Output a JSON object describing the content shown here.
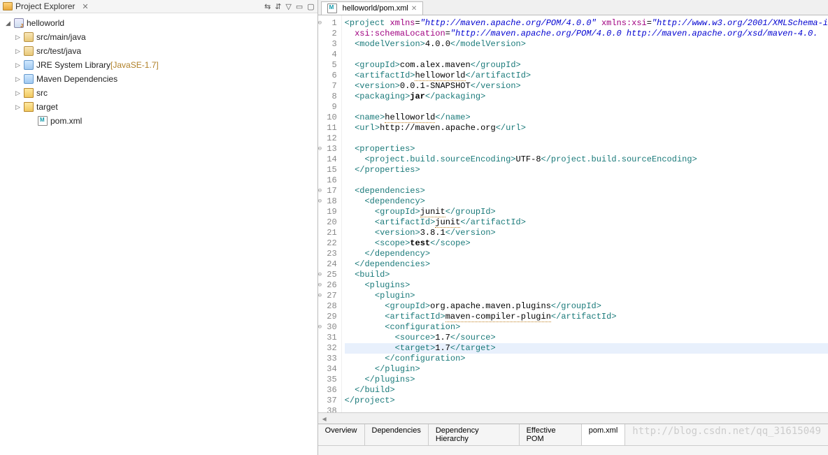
{
  "explorer": {
    "title": "Project Explorer",
    "project": "helloworld",
    "items": [
      {
        "label": "src/main/java",
        "icon": "pkg"
      },
      {
        "label": "src/test/java",
        "icon": "pkg"
      },
      {
        "label": "JRE System Library",
        "suffix": "[JavaSE-1.7]",
        "icon": "lib"
      },
      {
        "label": "Maven Dependencies",
        "icon": "lib"
      },
      {
        "label": "src",
        "icon": "foldr"
      },
      {
        "label": "target",
        "icon": "foldr"
      }
    ],
    "file": "pom.xml"
  },
  "editor": {
    "tab": "helloworld/pom.xml",
    "gutter_lines": 38,
    "fold_lines": [
      1,
      13,
      17,
      18,
      25,
      26,
      27,
      30
    ],
    "highlight_line": 32,
    "code_lines": [
      [
        {
          "t": "tag",
          "v": "<project"
        },
        {
          "t": "txt",
          "v": " "
        },
        {
          "t": "attrname",
          "v": "xmlns"
        },
        {
          "t": "txt",
          "v": "="
        },
        {
          "t": "str",
          "v": "\"http://maven.apache.org/POM/4.0.0\""
        },
        {
          "t": "txt",
          "v": " "
        },
        {
          "t": "attrname",
          "v": "xmlns:xsi"
        },
        {
          "t": "txt",
          "v": "="
        },
        {
          "t": "str",
          "v": "\"http://www.w3.org/2001/XMLSchema-i"
        }
      ],
      [
        {
          "t": "txt",
          "v": "  "
        },
        {
          "t": "attrname",
          "v": "xsi:schemaLocation"
        },
        {
          "t": "txt",
          "v": "="
        },
        {
          "t": "str",
          "v": "\"http://maven.apache.org/POM/4.0.0 http://maven.apache.org/xsd/maven-4.0."
        }
      ],
      [
        {
          "t": "txt",
          "v": "  "
        },
        {
          "t": "tag",
          "v": "<modelVersion>"
        },
        {
          "t": "txt",
          "v": "4.0.0"
        },
        {
          "t": "tag",
          "v": "</modelVersion>"
        }
      ],
      [
        {
          "t": "txt",
          "v": ""
        }
      ],
      [
        {
          "t": "txt",
          "v": "  "
        },
        {
          "t": "tag",
          "v": "<groupId>"
        },
        {
          "t": "txt",
          "v": "com.alex.maven"
        },
        {
          "t": "tag",
          "v": "</groupId>"
        }
      ],
      [
        {
          "t": "txt",
          "v": "  "
        },
        {
          "t": "tag",
          "v": "<artifactId>"
        },
        {
          "t": "under",
          "v": "helloworld"
        },
        {
          "t": "tag",
          "v": "</artifactId>"
        }
      ],
      [
        {
          "t": "txt",
          "v": "  "
        },
        {
          "t": "tag",
          "v": "<version>"
        },
        {
          "t": "txt",
          "v": "0.0.1-SNAPSHOT"
        },
        {
          "t": "tag",
          "v": "</version>"
        }
      ],
      [
        {
          "t": "txt",
          "v": "  "
        },
        {
          "t": "tag",
          "v": "<packaging>"
        },
        {
          "t": "kw",
          "v": "jar"
        },
        {
          "t": "tag",
          "v": "</packaging>"
        }
      ],
      [
        {
          "t": "txt",
          "v": ""
        }
      ],
      [
        {
          "t": "txt",
          "v": "  "
        },
        {
          "t": "tag",
          "v": "<name>"
        },
        {
          "t": "under",
          "v": "helloworld"
        },
        {
          "t": "tag",
          "v": "</name>"
        }
      ],
      [
        {
          "t": "txt",
          "v": "  "
        },
        {
          "t": "tag",
          "v": "<url>"
        },
        {
          "t": "txt",
          "v": "http://maven.apache.org"
        },
        {
          "t": "tag",
          "v": "</url>"
        }
      ],
      [
        {
          "t": "txt",
          "v": ""
        }
      ],
      [
        {
          "t": "txt",
          "v": "  "
        },
        {
          "t": "tag",
          "v": "<properties>"
        }
      ],
      [
        {
          "t": "txt",
          "v": "    "
        },
        {
          "t": "tag",
          "v": "<project.build.sourceEncoding>"
        },
        {
          "t": "txt",
          "v": "UTF-8"
        },
        {
          "t": "tag",
          "v": "</project.build.sourceEncoding>"
        }
      ],
      [
        {
          "t": "txt",
          "v": "  "
        },
        {
          "t": "tag",
          "v": "</properties>"
        }
      ],
      [
        {
          "t": "txt",
          "v": ""
        }
      ],
      [
        {
          "t": "txt",
          "v": "  "
        },
        {
          "t": "tag",
          "v": "<dependencies>"
        }
      ],
      [
        {
          "t": "txt",
          "v": "    "
        },
        {
          "t": "tag",
          "v": "<dependency>"
        }
      ],
      [
        {
          "t": "txt",
          "v": "      "
        },
        {
          "t": "tag",
          "v": "<groupId>"
        },
        {
          "t": "under",
          "v": "junit"
        },
        {
          "t": "tag",
          "v": "</groupId>"
        }
      ],
      [
        {
          "t": "txt",
          "v": "      "
        },
        {
          "t": "tag",
          "v": "<artifactId>"
        },
        {
          "t": "under",
          "v": "junit"
        },
        {
          "t": "tag",
          "v": "</artifactId>"
        }
      ],
      [
        {
          "t": "txt",
          "v": "      "
        },
        {
          "t": "tag",
          "v": "<version>"
        },
        {
          "t": "txt",
          "v": "3.8.1"
        },
        {
          "t": "tag",
          "v": "</version>"
        }
      ],
      [
        {
          "t": "txt",
          "v": "      "
        },
        {
          "t": "tag",
          "v": "<scope>"
        },
        {
          "t": "kw",
          "v": "test"
        },
        {
          "t": "tag",
          "v": "</scope>"
        }
      ],
      [
        {
          "t": "txt",
          "v": "    "
        },
        {
          "t": "tag",
          "v": "</dependency>"
        }
      ],
      [
        {
          "t": "txt",
          "v": "  "
        },
        {
          "t": "tag",
          "v": "</dependencies>"
        }
      ],
      [
        {
          "t": "txt",
          "v": "  "
        },
        {
          "t": "tag",
          "v": "<build>"
        }
      ],
      [
        {
          "t": "txt",
          "v": "    "
        },
        {
          "t": "tag",
          "v": "<plugins>"
        }
      ],
      [
        {
          "t": "txt",
          "v": "      "
        },
        {
          "t": "tag",
          "v": "<plugin>"
        }
      ],
      [
        {
          "t": "txt",
          "v": "        "
        },
        {
          "t": "tag",
          "v": "<groupId>"
        },
        {
          "t": "txt",
          "v": "org.apache.maven.plugins"
        },
        {
          "t": "tag",
          "v": "</groupId>"
        }
      ],
      [
        {
          "t": "txt",
          "v": "        "
        },
        {
          "t": "tag",
          "v": "<artifactId>"
        },
        {
          "t": "under",
          "v": "maven-compiler-plugin"
        },
        {
          "t": "tag",
          "v": "</artifactId>"
        }
      ],
      [
        {
          "t": "txt",
          "v": "        "
        },
        {
          "t": "tag",
          "v": "<configuration>"
        }
      ],
      [
        {
          "t": "txt",
          "v": "          "
        },
        {
          "t": "tag",
          "v": "<source>"
        },
        {
          "t": "txt",
          "v": "1.7"
        },
        {
          "t": "tag",
          "v": "</source>"
        }
      ],
      [
        {
          "t": "txt",
          "v": "          "
        },
        {
          "t": "tag",
          "v": "<target>"
        },
        {
          "t": "txt",
          "v": "1.7"
        },
        {
          "t": "tag",
          "v": "</target>"
        }
      ],
      [
        {
          "t": "txt",
          "v": "        "
        },
        {
          "t": "tag",
          "v": "</configuration>"
        }
      ],
      [
        {
          "t": "txt",
          "v": "      "
        },
        {
          "t": "tag",
          "v": "</plugin>"
        }
      ],
      [
        {
          "t": "txt",
          "v": "    "
        },
        {
          "t": "tag",
          "v": "</plugins>"
        }
      ],
      [
        {
          "t": "txt",
          "v": "  "
        },
        {
          "t": "tag",
          "v": "</build>"
        }
      ],
      [
        {
          "t": "tag",
          "v": "</project>"
        }
      ],
      [
        {
          "t": "txt",
          "v": ""
        }
      ]
    ]
  },
  "bottom_tabs": [
    "Overview",
    "Dependencies",
    "Dependency Hierarchy",
    "Effective POM",
    "pom.xml"
  ],
  "active_bottom_tab": 4,
  "watermark": "http://blog.csdn.net/qq_31615049"
}
